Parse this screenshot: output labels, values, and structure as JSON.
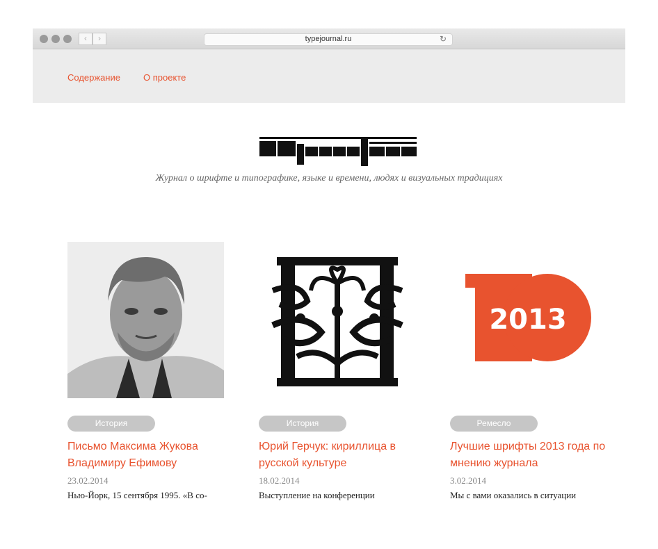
{
  "browser": {
    "url": "typejournal.ru",
    "back_glyph": "‹",
    "forward_glyph": "›",
    "reload_glyph": "↻"
  },
  "nav": {
    "items": [
      {
        "label": "Содержание"
      },
      {
        "label": "О проекте"
      }
    ]
  },
  "header": {
    "tagline": "Журнал о шрифте и типографике, языке и времени, людях и визуальных традициях"
  },
  "colors": {
    "accent": "#e8532f",
    "badge": "#c6c6c6"
  },
  "articles": [
    {
      "category": "История",
      "title": "Письмо Максима Жукова Владимиру Ефимову",
      "date": "23.02.2014",
      "excerpt": "Нью-Йорк, 15 сентября 1995. «В со-",
      "image": "portrait-photo"
    },
    {
      "category": "История",
      "title": "Юрий Герчук: кириллица в русской культуре",
      "date": "18.02.2014",
      "excerpt": "Выступление на конференции",
      "image": "ornamental-letter"
    },
    {
      "category": "Ремесло",
      "title": "Лучшие шрифты 2013 года по мнению журнала",
      "date": "3.02.2014",
      "excerpt": "Мы с вами оказались в ситуации",
      "image": "ten-2013-logo",
      "image_text": "2013"
    }
  ]
}
